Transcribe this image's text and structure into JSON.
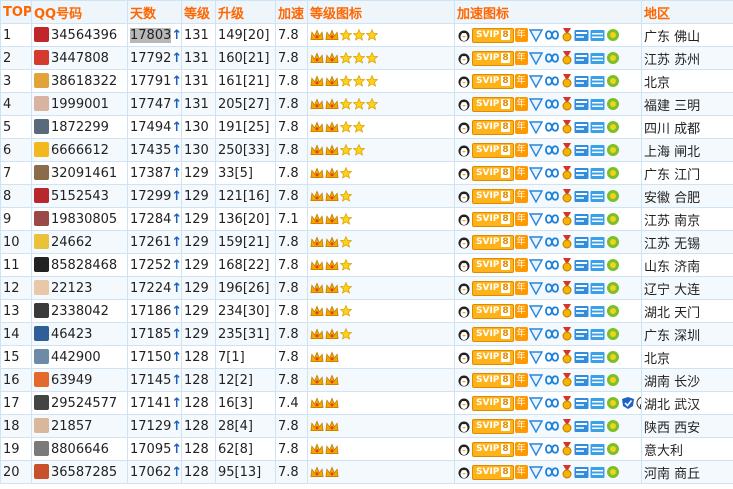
{
  "headers": {
    "top": "TOP",
    "qq": "QQ号码",
    "days": "天数",
    "level": "等级",
    "upgrade": "升级",
    "speed": "加速",
    "level_icons": "等级图标",
    "speed_icons": "加速图标",
    "region": "地区"
  },
  "colors": {
    "header_text": "#ff6600",
    "border": "#cfe3f3",
    "up_arrow": "#1b5fc1",
    "crown": "#f4a700",
    "star": "#f4c400"
  },
  "rows": [
    {
      "rank": "1",
      "qq": "34564396",
      "days": "17803",
      "arrow": "↑",
      "level": "131",
      "upgrade": "149[20]",
      "speed": "7.8",
      "crowns": 2,
      "suns": 0,
      "stars": 3,
      "region": "广东 佛山",
      "avatar": "#c0262c",
      "highlight": true,
      "accel": "full"
    },
    {
      "rank": "2",
      "qq": "3447808",
      "days": "17792",
      "arrow": "↑",
      "level": "131",
      "upgrade": "160[21]",
      "speed": "7.8",
      "crowns": 2,
      "suns": 0,
      "stars": 3,
      "region": "江苏 苏州",
      "avatar": "#d43a2e",
      "highlight": false,
      "accel": "full"
    },
    {
      "rank": "3",
      "qq": "38618322",
      "days": "17791",
      "arrow": "↑",
      "level": "131",
      "upgrade": "161[21]",
      "speed": "7.8",
      "crowns": 2,
      "suns": 0,
      "stars": 3,
      "region": "北京",
      "avatar": "#e2a33a",
      "highlight": false,
      "accel": "full"
    },
    {
      "rank": "4",
      "qq": "1999001",
      "days": "17747",
      "arrow": "↑",
      "level": "131",
      "upgrade": "205[27]",
      "speed": "7.8",
      "crowns": 2,
      "suns": 0,
      "stars": 3,
      "region": "福建 三明",
      "avatar": "#d7b3a0",
      "highlight": false,
      "accel": "full"
    },
    {
      "rank": "5",
      "qq": "1872299",
      "days": "17494",
      "arrow": "↑",
      "level": "130",
      "upgrade": "191[25]",
      "speed": "7.8",
      "crowns": 2,
      "suns": 0,
      "stars": 2,
      "region": "四川 成都",
      "avatar": "#5b6a7a",
      "highlight": false,
      "accel": "full"
    },
    {
      "rank": "6",
      "qq": "6666612",
      "days": "17435",
      "arrow": "↑",
      "level": "130",
      "upgrade": "250[33]",
      "speed": "7.8",
      "crowns": 2,
      "suns": 0,
      "stars": 2,
      "region": "上海 闸北",
      "avatar": "#f2b81e",
      "highlight": false,
      "accel": "full"
    },
    {
      "rank": "7",
      "qq": "32091461",
      "days": "17387",
      "arrow": "↑",
      "level": "129",
      "upgrade": "33[5]",
      "speed": "7.8",
      "crowns": 2,
      "suns": 0,
      "stars": 1,
      "region": "广东 江门",
      "avatar": "#8a6b4a",
      "highlight": false,
      "accel": "full"
    },
    {
      "rank": "8",
      "qq": "5152543",
      "days": "17299",
      "arrow": "↑",
      "level": "129",
      "upgrade": "121[16]",
      "speed": "7.8",
      "crowns": 2,
      "suns": 0,
      "stars": 1,
      "region": "安徽 合肥",
      "avatar": "#b8272d",
      "highlight": false,
      "accel": "full"
    },
    {
      "rank": "9",
      "qq": "19830805",
      "days": "17284",
      "arrow": "↑",
      "level": "129",
      "upgrade": "136[20]",
      "speed": "7.1",
      "crowns": 2,
      "suns": 0,
      "stars": 1,
      "region": "江苏 南京",
      "avatar": "#9b4848",
      "highlight": false,
      "accel": "full"
    },
    {
      "rank": "10",
      "qq": "24662",
      "days": "17261",
      "arrow": "↑",
      "level": "129",
      "upgrade": "159[21]",
      "speed": "7.8",
      "crowns": 2,
      "suns": 0,
      "stars": 1,
      "region": "江苏 无锡",
      "avatar": "#e9c23a",
      "highlight": false,
      "accel": "full"
    },
    {
      "rank": "11",
      "qq": "85828468",
      "days": "17252",
      "arrow": "↑",
      "level": "129",
      "upgrade": "168[22]",
      "speed": "7.8",
      "crowns": 2,
      "suns": 0,
      "stars": 1,
      "region": "山东 济南",
      "avatar": "#222222",
      "highlight": false,
      "accel": "full"
    },
    {
      "rank": "12",
      "qq": "22123",
      "days": "17224",
      "arrow": "↑",
      "level": "129",
      "upgrade": "196[26]",
      "speed": "7.8",
      "crowns": 2,
      "suns": 0,
      "stars": 1,
      "region": "辽宁 大连",
      "avatar": "#e8c8a8",
      "highlight": false,
      "accel": "full"
    },
    {
      "rank": "13",
      "qq": "2338042",
      "days": "17186",
      "arrow": "↑",
      "level": "129",
      "upgrade": "234[30]",
      "speed": "7.8",
      "crowns": 2,
      "suns": 0,
      "stars": 1,
      "region": "湖北 天门",
      "avatar": "#3a3a3a",
      "highlight": false,
      "accel": "full"
    },
    {
      "rank": "14",
      "qq": "46423",
      "days": "17185",
      "arrow": "↑",
      "level": "129",
      "upgrade": "235[31]",
      "speed": "7.8",
      "crowns": 2,
      "suns": 0,
      "stars": 1,
      "region": "广东 深圳",
      "avatar": "#2f5f9a",
      "highlight": false,
      "accel": "full"
    },
    {
      "rank": "15",
      "qq": "442900",
      "days": "17150",
      "arrow": "↑",
      "level": "128",
      "upgrade": "7[1]",
      "speed": "7.8",
      "crowns": 2,
      "suns": 0,
      "stars": 0,
      "region": "北京",
      "avatar": "#6d8aa6",
      "highlight": false,
      "accel": "full"
    },
    {
      "rank": "16",
      "qq": "63949",
      "days": "17145",
      "arrow": "↑",
      "level": "128",
      "upgrade": "12[2]",
      "speed": "7.8",
      "crowns": 2,
      "suns": 0,
      "stars": 0,
      "region": "湖南 长沙",
      "avatar": "#e26a2c",
      "highlight": false,
      "accel": "full"
    },
    {
      "rank": "17",
      "qq": "29524577",
      "days": "17141",
      "arrow": "↑",
      "level": "128",
      "upgrade": "16[3]",
      "speed": "7.4",
      "crowns": 2,
      "suns": 0,
      "stars": 0,
      "region": "湖北 武汉",
      "avatar": "#444444",
      "highlight": false,
      "accel": "extra"
    },
    {
      "rank": "18",
      "qq": "21857",
      "days": "17129",
      "arrow": "↑",
      "level": "128",
      "upgrade": "28[4]",
      "speed": "7.8",
      "crowns": 2,
      "suns": 0,
      "stars": 0,
      "region": "陕西 西安",
      "avatar": "#d9b79a",
      "highlight": false,
      "accel": "full"
    },
    {
      "rank": "19",
      "qq": "8806646",
      "days": "17095",
      "arrow": "↑",
      "level": "128",
      "upgrade": "62[8]",
      "speed": "7.8",
      "crowns": 2,
      "suns": 0,
      "stars": 0,
      "region": "意大利",
      "avatar": "#7a7a7a",
      "highlight": false,
      "accel": "full"
    },
    {
      "rank": "20",
      "qq": "36587285",
      "days": "17062",
      "arrow": "↑",
      "level": "128",
      "upgrade": "95[13]",
      "speed": "7.8",
      "crowns": 2,
      "suns": 0,
      "stars": 0,
      "region": "河南 商丘",
      "avatar": "#c8512b",
      "highlight": false,
      "accel": "full"
    }
  ],
  "accel_icons": {
    "svip_text": "SVIP",
    "svip_level": "8",
    "year_text": "年"
  }
}
